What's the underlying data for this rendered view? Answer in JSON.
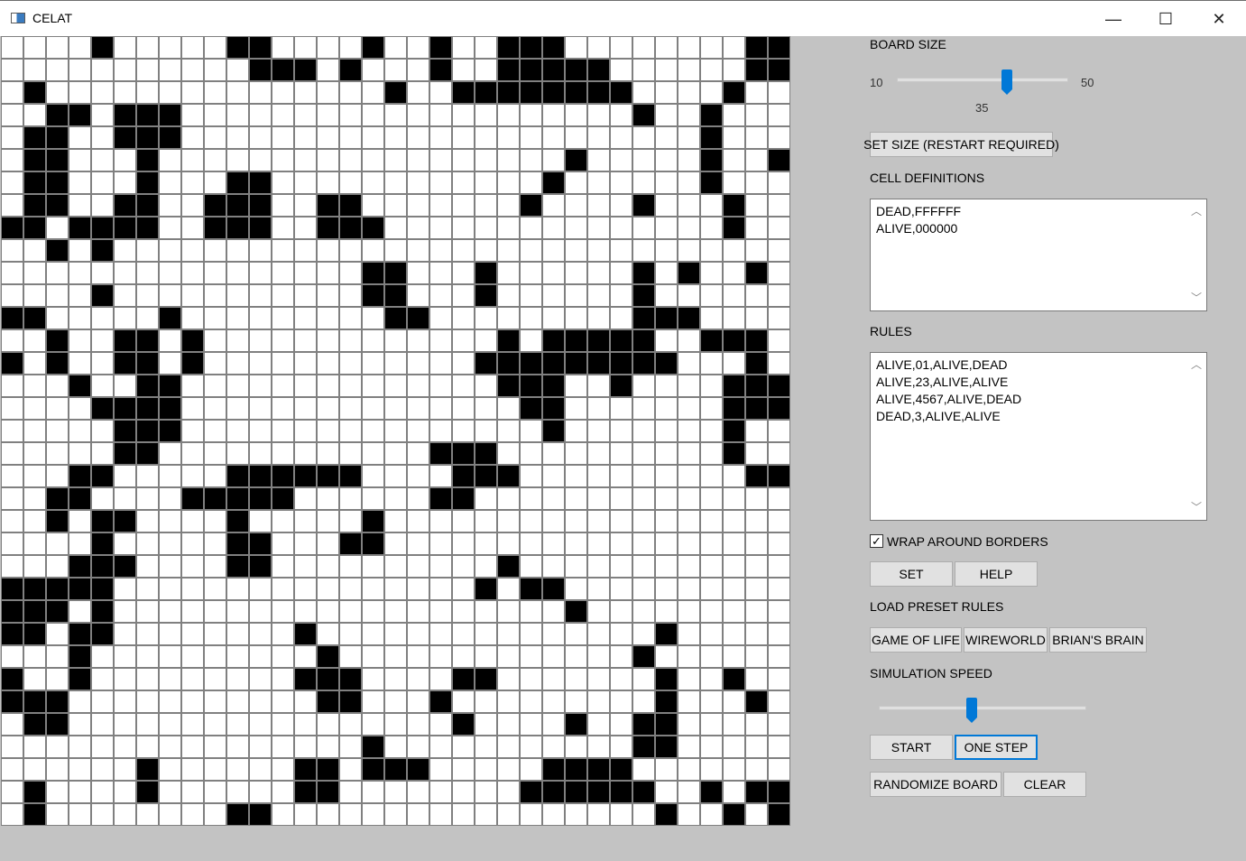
{
  "window": {
    "title": "CELAT",
    "minimize_glyph": "—",
    "maximize_glyph": "☐",
    "close_glyph": "✕",
    "app_icon": "app-window-icon"
  },
  "board": {
    "rows": 35,
    "cols": 35,
    "alive_color": "#000000",
    "dead_color": "#FFFFFF",
    "grid_color": "#808080",
    "cells": [
      "0000100000110000100100111000000001100",
      "0000000000011101000100111110000001100",
      "0100000000000000010011111111000010000",
      "0011011100000000000000000000100100000",
      "0110011100000000000000000000000100000",
      "0110001000000000000000000100000100110",
      "0110001000110000000000001000000100011",
      "0110011001110011000000010000100010000",
      "1101111001110011100000000000000010011",
      "0010100000000000000000000000000000010",
      "0000000000000000110001000000101001000",
      "0000100000000000110001000000100000000",
      "1100000100000000011000000000111000011",
      "0010011010000000000000101111100111000",
      "1010011010000000000001111111110001001",
      "0001001100000000000000111001000011110",
      "0000111100000000000000011000000011100",
      "0000011100000000000000001000000010000",
      "0000011000000000000111000000000010000",
      "0001100000111111000011100000000001100",
      "0011000011111000000110000000000000000",
      "0010110000100000100000000000000000000",
      "0000100000110001100000000000000000000",
      "0001110000110000000000100000000000000",
      "1111100000000000000001011000000000000",
      "1110100000000000000000000100000000000",
      "1101100000000100000000000000010000000",
      "0001000000000010000000000000100000000",
      "1001000000000111000011000000010010000",
      "1110000000000011000100000000010001000",
      "0110000000000000000010000100110000000",
      "0000000000000000100000000000110000000",
      "0000001000000110111000001111000000011",
      "0100001000000110000000011111100101101",
      "0100000000110000000000000000010010111"
    ]
  },
  "panel": {
    "board_size_label": "BOARD SIZE",
    "board_size_min": "10",
    "board_size_max": "50",
    "board_size_value": "35",
    "board_size_value_num": 35,
    "set_size_button": "SET SIZE (RESTART REQUIRED)",
    "cell_definitions_label": "CELL DEFINITIONS",
    "cell_definitions_lines": [
      "DEAD,FFFFFF",
      "ALIVE,000000"
    ],
    "rules_label": "RULES",
    "rules_lines": [
      "ALIVE,01,ALIVE,DEAD",
      "ALIVE,23,ALIVE,ALIVE",
      "ALIVE,4567,ALIVE,DEAD",
      "DEAD,3,ALIVE,ALIVE"
    ],
    "wrap_checkbox_label": "WRAP AROUND BORDERS",
    "wrap_checked": true,
    "check_glyph": "✓",
    "set_button": "SET",
    "help_button": "HELP",
    "load_preset_label": "LOAD PRESET RULES",
    "preset_game_of_life": "GAME OF LIFE",
    "preset_wireworld": "WIREWORLD",
    "preset_brians_brain": "BRIAN'S BRAIN",
    "simulation_speed_label": "SIMULATION SPEED",
    "simulation_speed_fraction": 0.45,
    "start_button": "START",
    "one_step_button": "ONE STEP",
    "randomize_button": "RANDOMIZE BOARD",
    "clear_button": "CLEAR",
    "scroll_up_glyph": "︿",
    "scroll_down_glyph": "﹀",
    "accent_color": "#0078d7"
  }
}
